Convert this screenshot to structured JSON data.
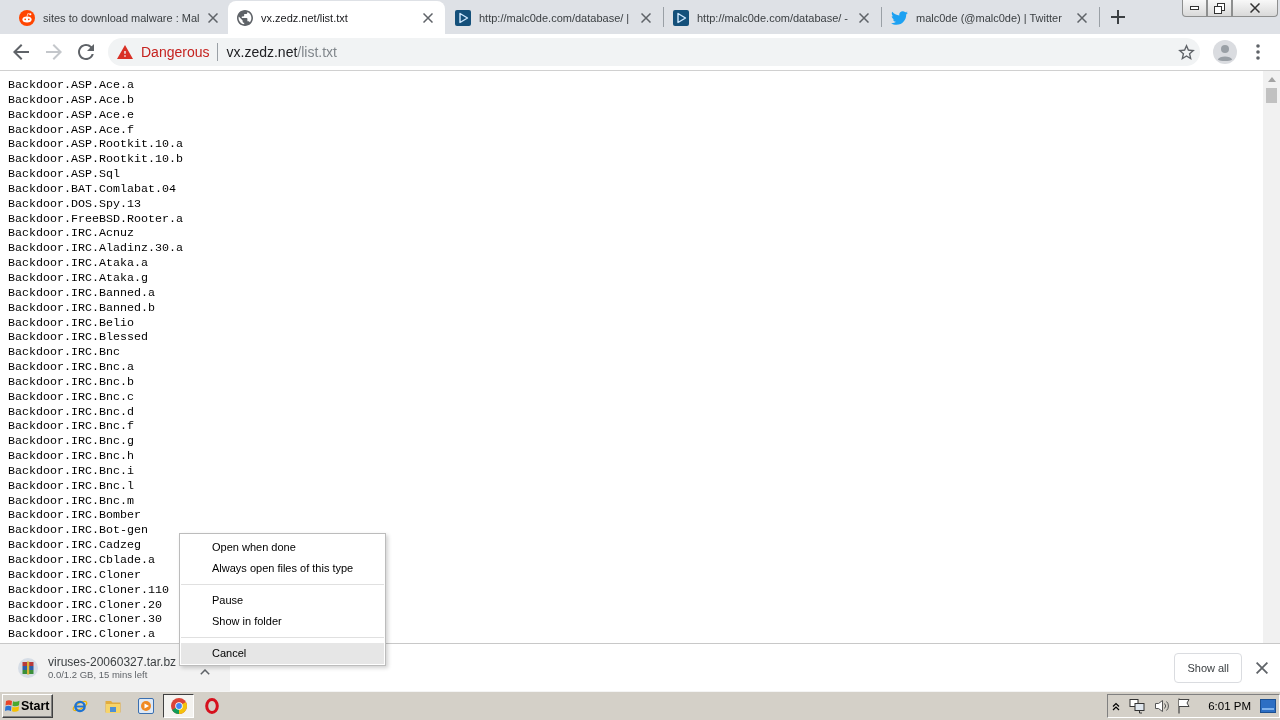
{
  "tabs": [
    {
      "title": "sites to download malware : Mal",
      "selected": false
    },
    {
      "title": "vx.zedz.net/list.txt",
      "selected": true
    },
    {
      "title": "http://malc0de.com/database/ |",
      "selected": false
    },
    {
      "title": "http://malc0de.com/database/ -",
      "selected": false
    },
    {
      "title": "malc0de (@malc0de) | Twitter",
      "selected": false
    }
  ],
  "toolbar": {
    "nav": [
      {
        "kind": "back",
        "disabled": false
      },
      {
        "kind": "forward",
        "disabled": true
      },
      {
        "kind": "reload",
        "disabled": false
      }
    ],
    "address_bar": {
      "security_label": "Dangerous",
      "host": "vx.zedz.net",
      "path": "/list.txt"
    }
  },
  "page": {
    "lines": [
      "Backdoor.ASP.Ace.a",
      "Backdoor.ASP.Ace.b",
      "Backdoor.ASP.Ace.e",
      "Backdoor.ASP.Ace.f",
      "Backdoor.ASP.Rootkit.10.a",
      "Backdoor.ASP.Rootkit.10.b",
      "Backdoor.ASP.Sql",
      "Backdoor.BAT.Comlabat.04",
      "Backdoor.DOS.Spy.13",
      "Backdoor.FreeBSD.Rooter.a",
      "Backdoor.IRC.Acnuz",
      "Backdoor.IRC.Aladinz.30.a",
      "Backdoor.IRC.Ataka.a",
      "Backdoor.IRC.Ataka.g",
      "Backdoor.IRC.Banned.a",
      "Backdoor.IRC.Banned.b",
      "Backdoor.IRC.Belio",
      "Backdoor.IRC.Blessed",
      "Backdoor.IRC.Bnc",
      "Backdoor.IRC.Bnc.a",
      "Backdoor.IRC.Bnc.b",
      "Backdoor.IRC.Bnc.c",
      "Backdoor.IRC.Bnc.d",
      "Backdoor.IRC.Bnc.f",
      "Backdoor.IRC.Bnc.g",
      "Backdoor.IRC.Bnc.h",
      "Backdoor.IRC.Bnc.i",
      "Backdoor.IRC.Bnc.l",
      "Backdoor.IRC.Bnc.m",
      "Backdoor.IRC.Bomber",
      "Backdoor.IRC.Bot-gen",
      "Backdoor.IRC.Cadzeg",
      "Backdoor.IRC.Cblade.a",
      "Backdoor.IRC.Cloner",
      "Backdoor.IRC.Cloner.110",
      "Backdoor.IRC.Cloner.20",
      "Backdoor.IRC.Cloner.30",
      "Backdoor.IRC.Cloner.a"
    ]
  },
  "context_menu": {
    "groups": [
      [
        {
          "label": "Open when done",
          "selected": false
        },
        {
          "label": "Always open files of this type",
          "selected": false
        }
      ],
      [
        {
          "label": "Pause",
          "selected": false
        },
        {
          "label": "Show in folder",
          "selected": false
        }
      ],
      [
        {
          "label": "Cancel",
          "selected": true
        }
      ]
    ]
  },
  "download_shelf": {
    "items": [
      {
        "filename": "viruses-20060327.tar.bz",
        "status": "0.0/1.2 GB, 15 mins left"
      }
    ],
    "show_all": "Show all"
  },
  "taskbar": {
    "start": "Start",
    "apps": [
      {
        "selected": false
      },
      {
        "selected": false
      },
      {
        "selected": false
      },
      {
        "selected": true
      },
      {
        "selected": false
      }
    ],
    "clock": "6:01 PM"
  }
}
